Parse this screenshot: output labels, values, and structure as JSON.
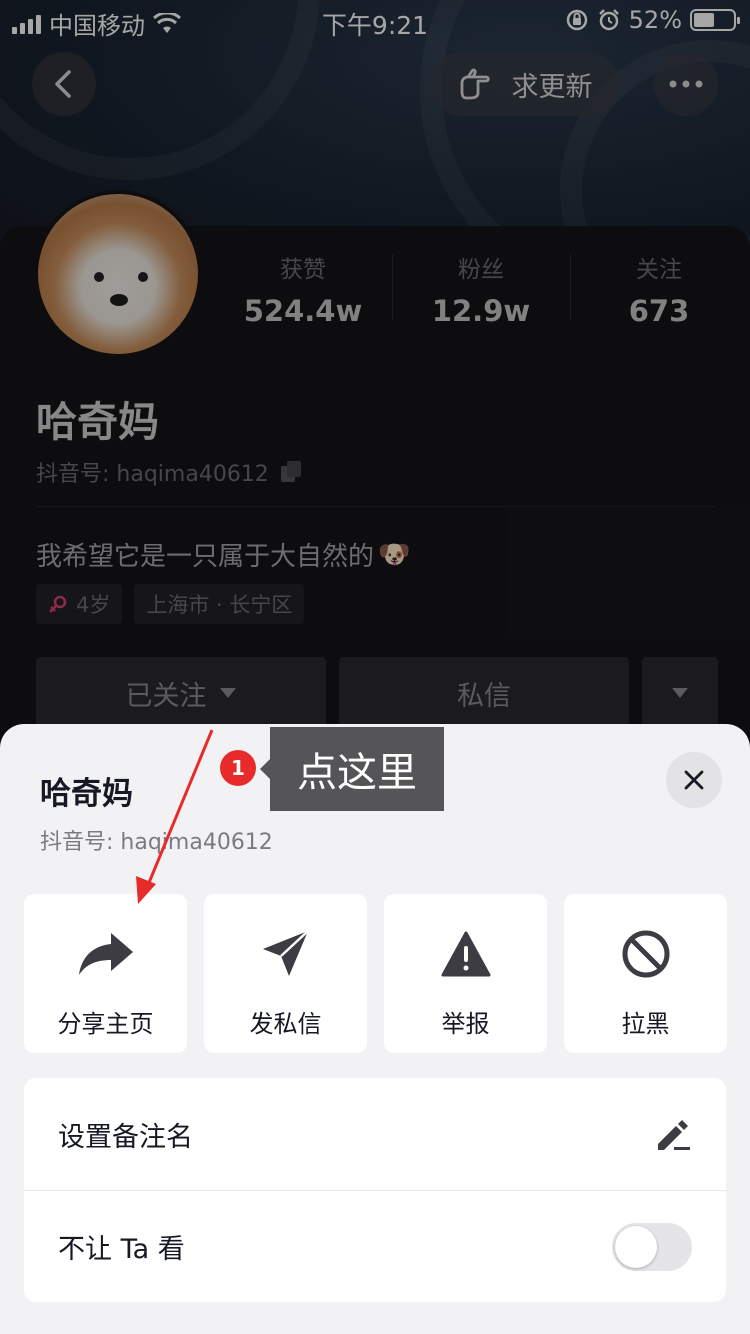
{
  "status_bar": {
    "carrier": "中国移动",
    "time": "下午9:21",
    "battery": "52%",
    "battery_level": 0.52
  },
  "nav": {
    "request_update_label": "求更新"
  },
  "profile": {
    "stats": [
      {
        "label": "获赞",
        "value": "524.4w"
      },
      {
        "label": "粉丝",
        "value": "12.9w"
      },
      {
        "label": "关注",
        "value": "673"
      }
    ],
    "name": "哈奇妈",
    "douyin_id": "抖音号: haqima40612",
    "bio": "我希望它是一只属于大自然的",
    "bio_emoji": "🐶",
    "tags": {
      "age": "4岁",
      "location": "上海市 · 长宁区"
    },
    "follow_label": "已关注",
    "message_label": "私信"
  },
  "sheet": {
    "name": "哈奇妈",
    "douyin_id": "抖音号: haqima40612",
    "tiles": [
      {
        "label": "分享主页",
        "icon": "share-arrow-icon"
      },
      {
        "label": "发私信",
        "icon": "paper-plane-icon"
      },
      {
        "label": "举报",
        "icon": "warning-icon"
      },
      {
        "label": "拉黑",
        "icon": "block-icon"
      }
    ],
    "list": [
      {
        "label": "设置备注名",
        "icon": "edit-pencil-icon"
      },
      {
        "label": "不让 Ta 看",
        "toggle_on": false
      }
    ]
  },
  "annotation": {
    "badge": "1",
    "tooltip": "点这里"
  },
  "colors": {
    "accent_red": "#e82a2a",
    "sheet_bg": "#f2f2f5",
    "dark_bg": "#15151a"
  }
}
